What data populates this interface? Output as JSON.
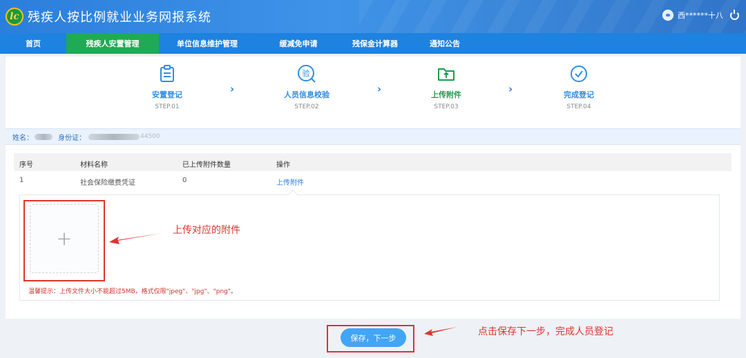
{
  "header": {
    "logo_text": "lc",
    "title": "残疾人按比例就业业务网报系统",
    "user_name": "西******十八"
  },
  "nav": {
    "items": [
      {
        "label": "首页",
        "active": false
      },
      {
        "label": "残疾人安置管理",
        "active": true
      },
      {
        "label": "单位信息维护管理",
        "active": false
      },
      {
        "label": "缓减免申请",
        "active": false
      },
      {
        "label": "残保金计算器",
        "active": false
      },
      {
        "label": "通知公告",
        "active": false
      }
    ]
  },
  "steps": [
    {
      "label": "安置登记",
      "step": "STEP.01",
      "icon": "clipboard-icon"
    },
    {
      "label": "人员信息校验",
      "step": "STEP.02",
      "icon": "verify-icon",
      "icon_char": "验"
    },
    {
      "label": "上传附件",
      "step": "STEP.03",
      "icon": "upload-folder-icon"
    },
    {
      "label": "完成登记",
      "step": "STEP.04",
      "icon": "check-circle-icon"
    }
  ],
  "chevron": "›",
  "info": {
    "name_label": "姓名：",
    "id_label": "身份证：",
    "id_suffix": "44500"
  },
  "table": {
    "headers": [
      "序号",
      "材料名称",
      "已上传附件数量",
      "操作"
    ],
    "rows": [
      {
        "index": "1",
        "name": "社会保险缴费凭证",
        "count": "0",
        "action": "上传附件"
      }
    ]
  },
  "upload": {
    "plus": "+",
    "tip": "温馨提示：上传文件大小不能超过5MB，格式仅限\"jpeg\"、\"jpg\"、\"png\"。"
  },
  "annotations": {
    "upload_hint": "上传对应的附件",
    "save_hint": "点击保存下一步，完成人员登记"
  },
  "save_button": "保存，下一步",
  "colors": {
    "header_blue": "#2b7fdc",
    "nav_active_green": "#1faa55",
    "annotation_red": "#e0322c",
    "button_blue": "#42a5f5"
  }
}
